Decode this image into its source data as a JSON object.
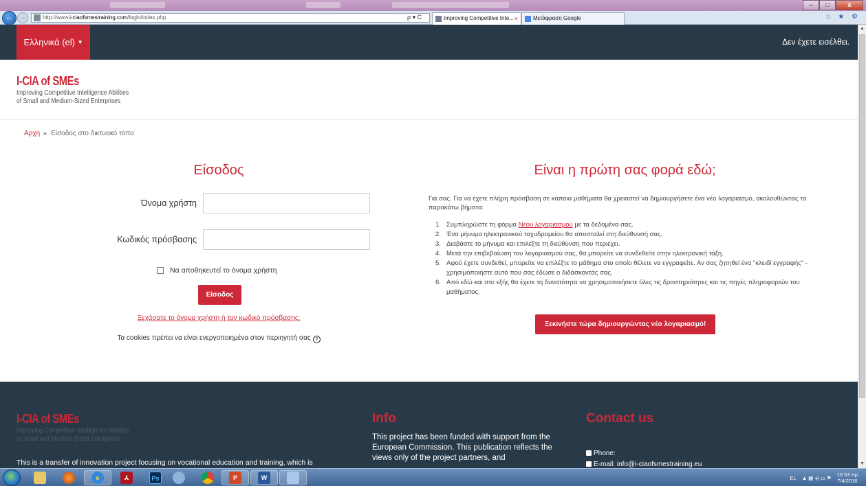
{
  "browser": {
    "url_prefix": "http://www.",
    "url_host": "i-ciaofsmestraining.com",
    "url_path": "/login/index.php",
    "addr_tools": "ρ ▾ C",
    "tabs": [
      {
        "label": "Improving Competitive Inte...",
        "close": "×"
      },
      {
        "label": "Μετάφραση Google"
      }
    ],
    "right_icons": "⌂ ★ ⚙",
    "win_controls": {
      "minimize": "–",
      "maximize": "□",
      "close": "x"
    },
    "back_glyph": "←",
    "fwd_glyph": "→"
  },
  "navbar": {
    "language": "Ελληνικά (el)",
    "caret": "▼",
    "login_status": "Δεν έχετε εισέλθει."
  },
  "brand": {
    "name": "I-CIA of SMEs",
    "sub1": "Improving Competitive Intelligence Abilities",
    "sub2": "of Small and Medium-Sized Enterprises"
  },
  "breadcrumb": {
    "home": "Αρχή",
    "sep": "►",
    "current": "Είσοδος στο δικτυακό τόπο"
  },
  "login": {
    "title": "Είσοδος",
    "username_label": "Όνομα χρήστη",
    "password_label": "Κωδικός πρόσβασης",
    "remember_label": "Να αποθηκευτεί το όνομα χρήστη",
    "button": "Είσοδος",
    "forgot_link": "Ξεχάσατε το όνομα χρήστη ή τον κωδικό πρόσβασης;",
    "cookies_note": "Τα cookies πρέπει να είναι ενεργοποιημένα στον περιηγητή σας",
    "help_glyph": "?"
  },
  "signup": {
    "title": "Είναι η πρώτη σας φορά εδώ;",
    "intro": "Για σας. Για να έχετε πλήρη πρόσβαση σε κάποια μαθήματα θα χρειαστεί να δημιουργήσετε ένα νέο λογαριασμό, ακολουθώντας τα παρακάτω βήματα:",
    "steps": [
      {
        "num": "1.",
        "pre": "Συμπληρώστε τη φόρμα ",
        "link": "Νέου λογαριασμού",
        "post": " με τα δεδομένα σας."
      },
      {
        "num": "2.",
        "text": "Ένα μήνυμα ηλεκτρονικού ταχυδρομείου θα αποσταλεί στη διεύθυνσή σας."
      },
      {
        "num": "3.",
        "text": "Διαβάστε το μήνυμα και επιλέξτε τη διεύθυνση που περιέχει."
      },
      {
        "num": "4.",
        "text": "Μετά την επιβεβαίωση του λογαριασμού σας, θα μπορείτε να συνδεθείτε στην ηλεκτρονική τάξη."
      },
      {
        "num": "5.",
        "text": "Αφού έχετε συνδεθεί, μπορείτε να επιλέξτε το μάθημα στο οποίο θέλετε να εγγραφείτε. Αν σας ζητηθεί ένα \"κλειδί εγγραφής\" - χρησιμοποιήστε αυτό που σας έδωσε ο διδάσκοντάς σας."
      },
      {
        "num": "6.",
        "text": "Από εδώ και στο εξής θα έχετε τη δυνατότητα να χρησιμοποιήσετε όλες τις δραστηριότητες και τις πηγές πληροφοριών του μαθήματος."
      }
    ],
    "button": "Ξεκινήστε τώρα δημιουργώντας νέο λογαριασμό!"
  },
  "footer": {
    "about": "This is a transfer of innovation project focusing on vocational education and training, which is",
    "info_title": "Info",
    "info_text": "This project has been funded with support from the European Commission. This publication reflects the views only of the project partners, and",
    "contact_title": "Contact us",
    "phone": "Phone:",
    "email": "E-mail: info@i-ciaofsmestraining.eu"
  },
  "taskbar": {
    "items": [
      "folder-icon",
      "firefox-icon",
      "ie-icon",
      "acrobat-icon",
      "photoshop-icon",
      "network-icon",
      "chrome-icon",
      "powerpoint-icon",
      "word-icon",
      "generic-app-icon"
    ],
    "ps_label": "Ps",
    "pp_label": "P",
    "word_label": "W",
    "acrobat_label": "⅄",
    "lang": "EL",
    "tray_icons": "▲ ▦ ◂) ▭ ⚑",
    "time": "10:53 πμ",
    "date": "7/4/2016"
  }
}
